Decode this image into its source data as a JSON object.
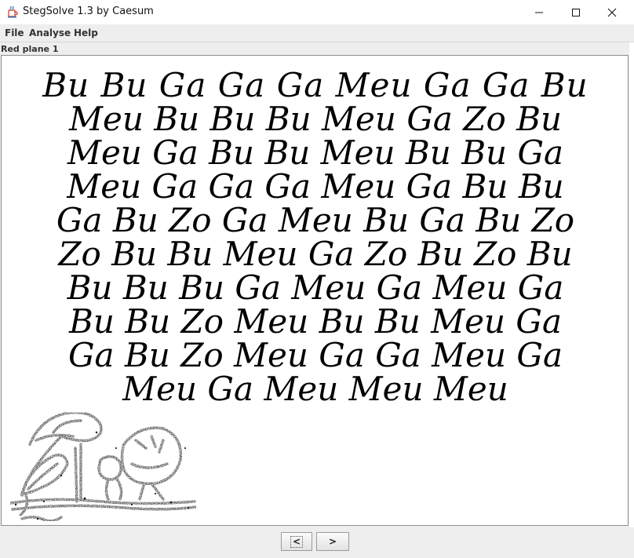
{
  "window": {
    "title": "StegSolve 1.3 by Caesum"
  },
  "menu": {
    "items": [
      "File",
      "Analyse",
      "Help"
    ]
  },
  "view": {
    "plane_label": "Red plane 1",
    "text_lines": [
      "Bu Bu Ga Ga Ga Meu Ga Ga Bu",
      "Meu Bu Bu Bu Meu Ga Zo Bu",
      "Meu Ga Bu Bu Meu Bu Bu Ga",
      "Meu Ga Ga Ga Meu Ga Bu Bu",
      "Ga Bu Zo Ga Meu Bu Ga Bu Zo",
      "Zo Bu Bu Meu Ga Zo Bu Zo Bu",
      "Bu Bu Bu Ga Meu Ga Meu Ga",
      "Bu Bu Zo Meu Bu Bu Meu Ga",
      "Ga Bu Zo Meu Ga Ga Meu Ga",
      "Meu Ga Meu Meu Meu"
    ]
  },
  "nav": {
    "prev_label": "<",
    "next_label": ">"
  },
  "colors": {
    "titlebar": "#ffffff",
    "panel_bg": "#ffffff",
    "text": "#000000",
    "chrome": "#eeeeee"
  },
  "icons": {
    "app": "java-cup-icon",
    "minimize": "minimize-icon",
    "maximize": "maximize-icon",
    "close": "close-icon"
  }
}
